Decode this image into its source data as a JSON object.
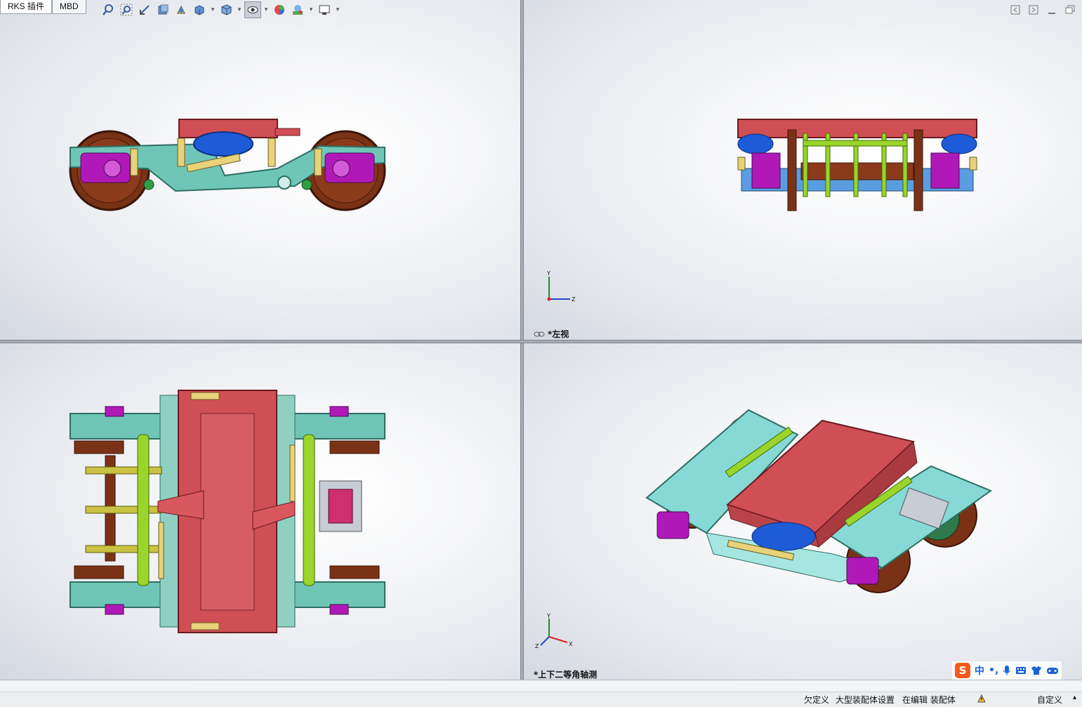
{
  "tabs": [
    {
      "label": "RKS 插件",
      "active": true
    },
    {
      "label": "MBD",
      "active": false
    }
  ],
  "toolbar_icons": [
    "zoom-to-fit-icon",
    "zoom-to-area-icon",
    "previous-view-icon",
    "section-view-icon",
    "view-selector-icon",
    "view-orientation-icon",
    "display-style-icon",
    "hide-show-items-icon",
    "edit-appearance-icon",
    "apply-scene-icon",
    "view-settings-icon"
  ],
  "viewports": {
    "top_left": {
      "label": ""
    },
    "top_right": {
      "label": "*左视",
      "triad": {
        "up": "Y",
        "right": "Z"
      }
    },
    "bottom_left": {
      "label": ""
    },
    "bottom_right": {
      "label": "*上下二等角轴测",
      "triad": {
        "up": "Y",
        "right": "X",
        "diag": "Z"
      }
    }
  },
  "colors": {
    "frame": "#cf4f55",
    "sideframe": "#6fc6b6",
    "motor": "#b019b8",
    "wheel": "#7a3216",
    "link": "#9bd42a",
    "damper": "#e8d27a",
    "airspring": "#1e5bd6"
  },
  "statusbar": {
    "under_defined": "欠定义",
    "large_assembly": "大型装配体设置",
    "editing": "在编辑 装配体",
    "custom": "自定义"
  },
  "ime": {
    "lang": "中",
    "punct": "•,",
    "mic": "mic-icon",
    "keyboard": "keyboard-icon",
    "skin": "skin-icon",
    "game": "game-icon"
  }
}
